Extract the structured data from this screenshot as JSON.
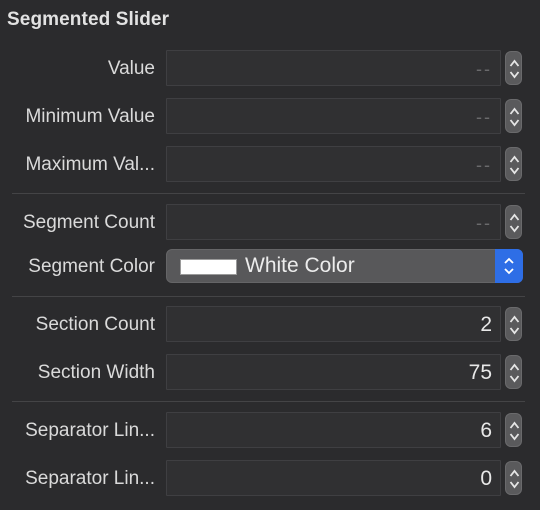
{
  "section_title": "Segmented Slider",
  "rows": [
    {
      "label": "Value",
      "value": "--",
      "empty": true
    },
    {
      "label": "Minimum Value",
      "value": "--",
      "empty": true
    },
    {
      "label": "Maximum Val...",
      "value": "--",
      "empty": true
    },
    {
      "label": "Segment Count",
      "value": "--",
      "empty": true
    },
    {
      "label": "Section Count",
      "value": "2",
      "empty": false
    },
    {
      "label": "Section Width",
      "value": "75",
      "empty": false
    },
    {
      "label": "Separator Lin...",
      "value": "6",
      "empty": false
    },
    {
      "label": "Separator Lin...",
      "value": "0",
      "empty": false
    }
  ],
  "segment_color": {
    "label": "Segment Color",
    "value": "White Color",
    "swatch": "#ffffff"
  },
  "colors": {
    "background": "#2b2b2d",
    "accent": "#2e6ee6"
  },
  "icons": {
    "stepper": "stepper-arrows-icon",
    "popup": "popup-chevrons-icon"
  }
}
